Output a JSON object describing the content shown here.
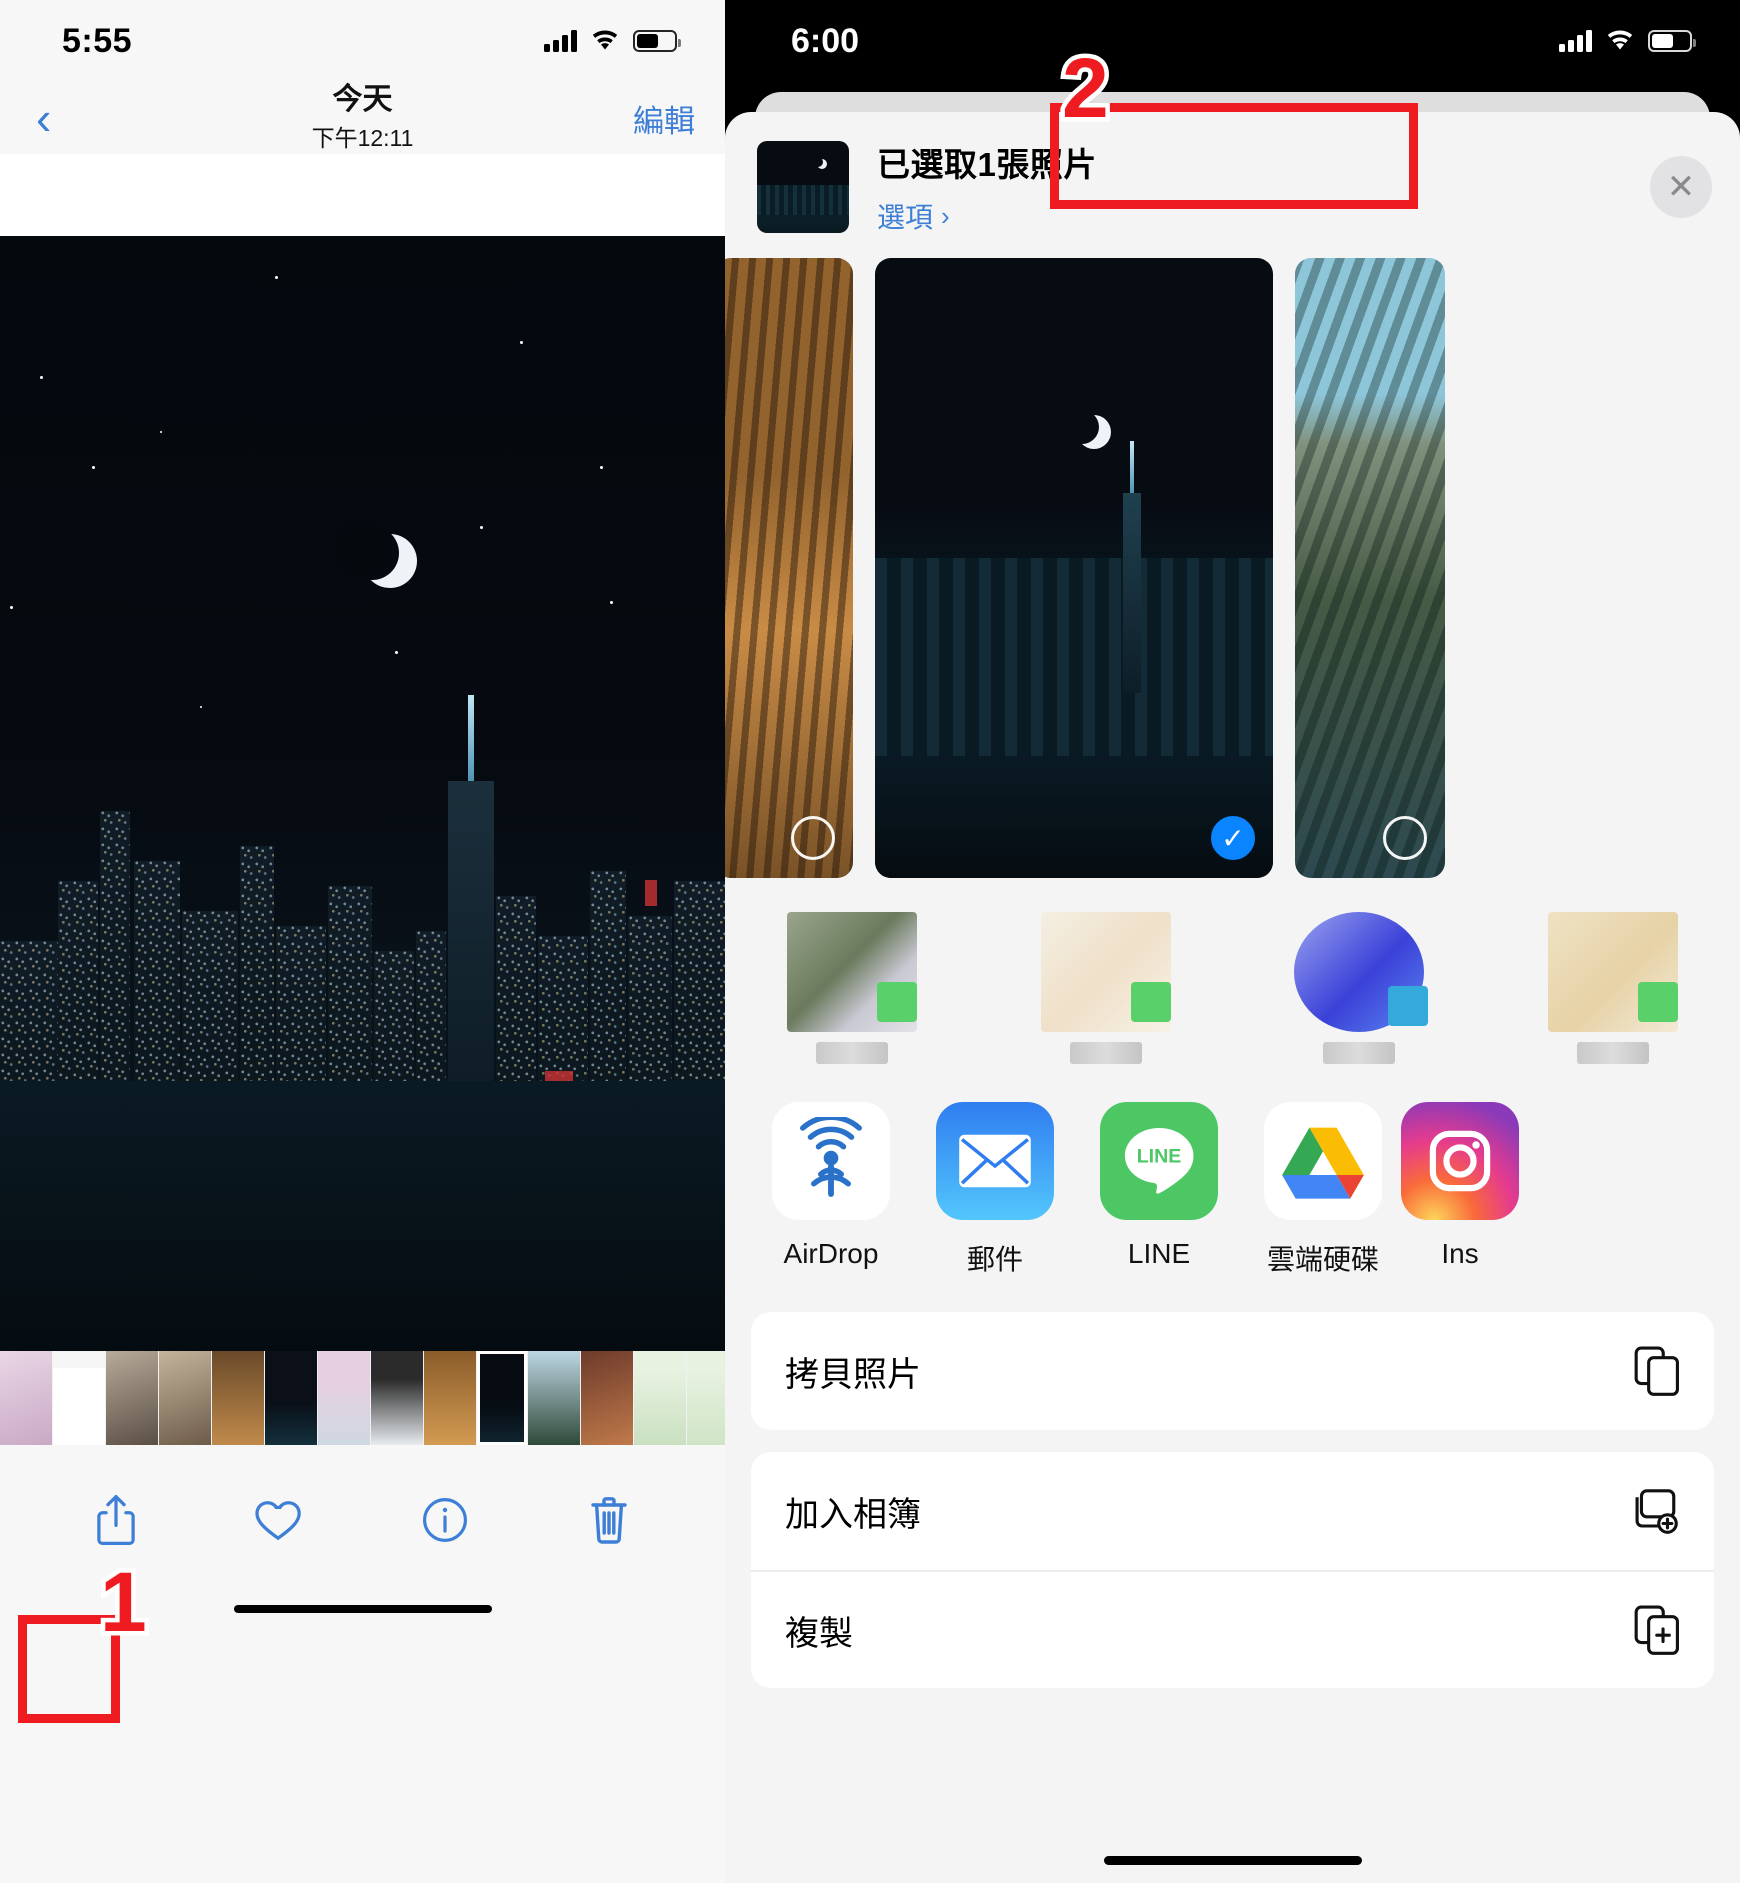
{
  "left": {
    "status": {
      "time": "5:55",
      "signal_icon": "cellular-bars-icon",
      "wifi_icon": "wifi-icon",
      "battery_icon": "battery-icon"
    },
    "nav": {
      "back_icon": "chevron-left-icon",
      "title": "今天",
      "subtitle": "下午12:11",
      "edit_label": "編輯"
    },
    "toolbar": {
      "share_icon": "share-icon",
      "favorite_icon": "heart-icon",
      "info_icon": "info-icon",
      "delete_icon": "trash-icon"
    },
    "annotation": {
      "number": "1"
    }
  },
  "right": {
    "status": {
      "time": "6:00",
      "signal_icon": "cellular-bars-icon",
      "wifi_icon": "wifi-icon",
      "battery_icon": "battery-icon"
    },
    "sheet_header": {
      "title": "已選取1張照片",
      "options_label": "選項",
      "options_chevron": "chevron-right-icon",
      "close_icon": "close-icon"
    },
    "carousel": [
      {
        "name": "autumn-forest-photo",
        "selected": false
      },
      {
        "name": "city-night-skyline-photo",
        "selected": true
      },
      {
        "name": "mountain-lake-photo",
        "selected": false
      }
    ],
    "apps": [
      {
        "label": "AirDrop",
        "icon": "airdrop-icon"
      },
      {
        "label": "郵件",
        "icon": "mail-icon"
      },
      {
        "label": "LINE",
        "icon": "line-icon"
      },
      {
        "label": "雲端硬碟",
        "icon": "google-drive-icon"
      },
      {
        "label": "Ins",
        "icon": "instagram-icon"
      }
    ],
    "actions": [
      {
        "label": "拷貝照片",
        "icon": "copy-icon"
      },
      {
        "label": "加入相簿",
        "icon": "add-to-album-icon"
      },
      {
        "label": "複製",
        "icon": "duplicate-icon"
      }
    ],
    "annotation": {
      "number": "2"
    }
  },
  "colors": {
    "ios_blue": "#3d7fd6",
    "accent_red": "#ee1c20",
    "selected_blue": "#0a84ff",
    "sheet_bg": "#f4f4f4"
  }
}
